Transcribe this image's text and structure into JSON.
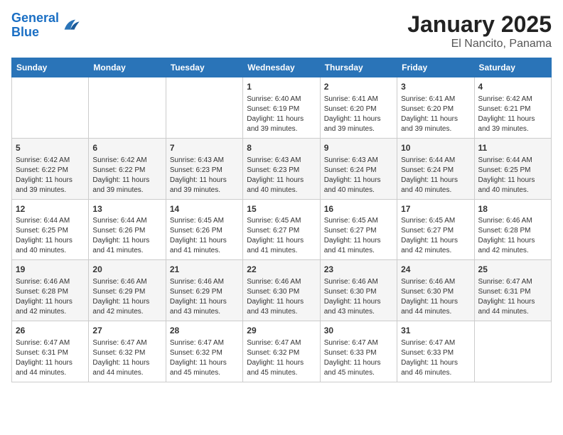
{
  "header": {
    "logo_line1": "General",
    "logo_line2": "Blue",
    "title": "January 2025",
    "subtitle": "El Nancito, Panama"
  },
  "days_of_week": [
    "Sunday",
    "Monday",
    "Tuesday",
    "Wednesday",
    "Thursday",
    "Friday",
    "Saturday"
  ],
  "weeks": [
    [
      {
        "day": "",
        "info": ""
      },
      {
        "day": "",
        "info": ""
      },
      {
        "day": "",
        "info": ""
      },
      {
        "day": "1",
        "info": "Sunrise: 6:40 AM\nSunset: 6:19 PM\nDaylight: 11 hours and 39 minutes."
      },
      {
        "day": "2",
        "info": "Sunrise: 6:41 AM\nSunset: 6:20 PM\nDaylight: 11 hours and 39 minutes."
      },
      {
        "day": "3",
        "info": "Sunrise: 6:41 AM\nSunset: 6:20 PM\nDaylight: 11 hours and 39 minutes."
      },
      {
        "day": "4",
        "info": "Sunrise: 6:42 AM\nSunset: 6:21 PM\nDaylight: 11 hours and 39 minutes."
      }
    ],
    [
      {
        "day": "5",
        "info": "Sunrise: 6:42 AM\nSunset: 6:22 PM\nDaylight: 11 hours and 39 minutes."
      },
      {
        "day": "6",
        "info": "Sunrise: 6:42 AM\nSunset: 6:22 PM\nDaylight: 11 hours and 39 minutes."
      },
      {
        "day": "7",
        "info": "Sunrise: 6:43 AM\nSunset: 6:23 PM\nDaylight: 11 hours and 39 minutes."
      },
      {
        "day": "8",
        "info": "Sunrise: 6:43 AM\nSunset: 6:23 PM\nDaylight: 11 hours and 40 minutes."
      },
      {
        "day": "9",
        "info": "Sunrise: 6:43 AM\nSunset: 6:24 PM\nDaylight: 11 hours and 40 minutes."
      },
      {
        "day": "10",
        "info": "Sunrise: 6:44 AM\nSunset: 6:24 PM\nDaylight: 11 hours and 40 minutes."
      },
      {
        "day": "11",
        "info": "Sunrise: 6:44 AM\nSunset: 6:25 PM\nDaylight: 11 hours and 40 minutes."
      }
    ],
    [
      {
        "day": "12",
        "info": "Sunrise: 6:44 AM\nSunset: 6:25 PM\nDaylight: 11 hours and 40 minutes."
      },
      {
        "day": "13",
        "info": "Sunrise: 6:44 AM\nSunset: 6:26 PM\nDaylight: 11 hours and 41 minutes."
      },
      {
        "day": "14",
        "info": "Sunrise: 6:45 AM\nSunset: 6:26 PM\nDaylight: 11 hours and 41 minutes."
      },
      {
        "day": "15",
        "info": "Sunrise: 6:45 AM\nSunset: 6:27 PM\nDaylight: 11 hours and 41 minutes."
      },
      {
        "day": "16",
        "info": "Sunrise: 6:45 AM\nSunset: 6:27 PM\nDaylight: 11 hours and 41 minutes."
      },
      {
        "day": "17",
        "info": "Sunrise: 6:45 AM\nSunset: 6:27 PM\nDaylight: 11 hours and 42 minutes."
      },
      {
        "day": "18",
        "info": "Sunrise: 6:46 AM\nSunset: 6:28 PM\nDaylight: 11 hours and 42 minutes."
      }
    ],
    [
      {
        "day": "19",
        "info": "Sunrise: 6:46 AM\nSunset: 6:28 PM\nDaylight: 11 hours and 42 minutes."
      },
      {
        "day": "20",
        "info": "Sunrise: 6:46 AM\nSunset: 6:29 PM\nDaylight: 11 hours and 42 minutes."
      },
      {
        "day": "21",
        "info": "Sunrise: 6:46 AM\nSunset: 6:29 PM\nDaylight: 11 hours and 43 minutes."
      },
      {
        "day": "22",
        "info": "Sunrise: 6:46 AM\nSunset: 6:30 PM\nDaylight: 11 hours and 43 minutes."
      },
      {
        "day": "23",
        "info": "Sunrise: 6:46 AM\nSunset: 6:30 PM\nDaylight: 11 hours and 43 minutes."
      },
      {
        "day": "24",
        "info": "Sunrise: 6:46 AM\nSunset: 6:30 PM\nDaylight: 11 hours and 44 minutes."
      },
      {
        "day": "25",
        "info": "Sunrise: 6:47 AM\nSunset: 6:31 PM\nDaylight: 11 hours and 44 minutes."
      }
    ],
    [
      {
        "day": "26",
        "info": "Sunrise: 6:47 AM\nSunset: 6:31 PM\nDaylight: 11 hours and 44 minutes."
      },
      {
        "day": "27",
        "info": "Sunrise: 6:47 AM\nSunset: 6:32 PM\nDaylight: 11 hours and 44 minutes."
      },
      {
        "day": "28",
        "info": "Sunrise: 6:47 AM\nSunset: 6:32 PM\nDaylight: 11 hours and 45 minutes."
      },
      {
        "day": "29",
        "info": "Sunrise: 6:47 AM\nSunset: 6:32 PM\nDaylight: 11 hours and 45 minutes."
      },
      {
        "day": "30",
        "info": "Sunrise: 6:47 AM\nSunset: 6:33 PM\nDaylight: 11 hours and 45 minutes."
      },
      {
        "day": "31",
        "info": "Sunrise: 6:47 AM\nSunset: 6:33 PM\nDaylight: 11 hours and 46 minutes."
      },
      {
        "day": "",
        "info": ""
      }
    ]
  ]
}
